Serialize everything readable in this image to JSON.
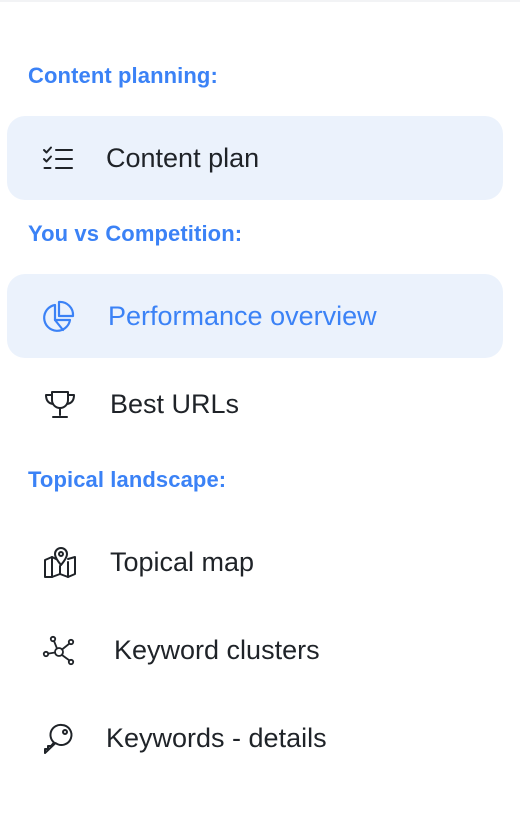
{
  "sections": {
    "content_planning": {
      "title": "Content planning:",
      "items": [
        {
          "label": "Content plan",
          "icon": "checklist-icon"
        }
      ]
    },
    "competition": {
      "title": "You vs Competition:",
      "items": [
        {
          "label": "Performance overview",
          "icon": "pie-chart-icon",
          "active": true
        },
        {
          "label": "Best URLs",
          "icon": "trophy-icon"
        }
      ]
    },
    "topical": {
      "title": "Topical landscape:",
      "items": [
        {
          "label": "Topical map",
          "icon": "map-pin-icon"
        },
        {
          "label": "Keyword clusters",
          "icon": "network-icon"
        },
        {
          "label": "Keywords - details",
          "icon": "key-icon"
        }
      ]
    }
  },
  "colors": {
    "accent": "#3b82f6",
    "active_bg": "#ebf2fc",
    "text": "#1f2328"
  }
}
